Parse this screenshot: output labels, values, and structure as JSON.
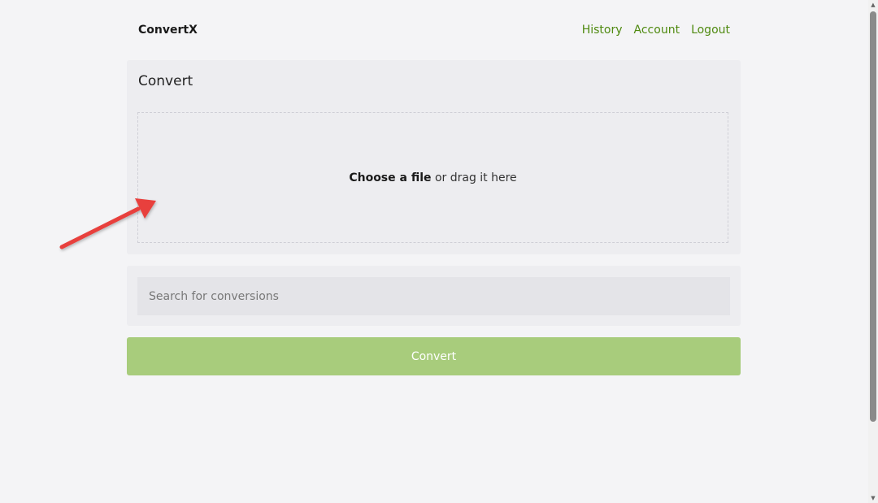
{
  "header": {
    "brand": "ConvertX",
    "nav": {
      "history": "History",
      "account": "Account",
      "logout": "Logout"
    }
  },
  "convert_card": {
    "title": "Convert",
    "dropzone": {
      "choose_label": "Choose a file",
      "drag_text": " or drag it here"
    }
  },
  "search": {
    "placeholder": "Search for conversions",
    "value": ""
  },
  "convert_button": {
    "label": "Convert"
  },
  "colors": {
    "accent": "#4f8a10",
    "button": "#a8cc7c",
    "annotation": "#e8413c"
  },
  "icons": {
    "annotation": "red-pointer-arrow-icon",
    "scroll_up": "scroll-up-arrow-icon",
    "scroll_down": "scroll-down-arrow-icon"
  }
}
